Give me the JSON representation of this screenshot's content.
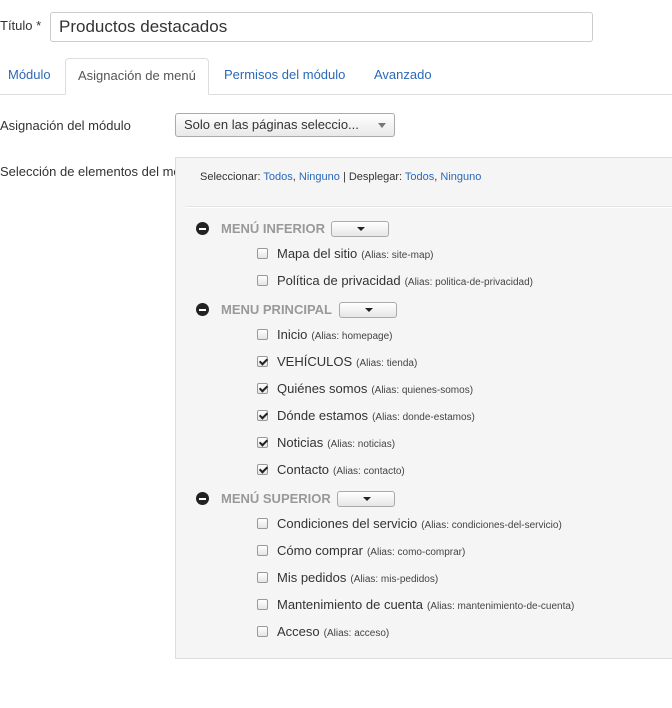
{
  "title_field": {
    "label": "Título *",
    "value": "Productos destacados"
  },
  "tabs": [
    {
      "label": "Módulo",
      "active": false
    },
    {
      "label": "Asignación de menú",
      "active": true
    },
    {
      "label": "Permisos del módulo",
      "active": false
    },
    {
      "label": "Avanzado",
      "active": false
    }
  ],
  "assignment": {
    "label": "Asignación del módulo",
    "selected": "Solo en las páginas seleccio..."
  },
  "selection": {
    "label": "Selección de elementos del menú:",
    "toolbar": {
      "select_label": "Seleccionar:",
      "all": "Todos",
      "none": "Ninguno",
      "sep": "|",
      "expand_label": "Desplegar:",
      "expand_all": "Todos",
      "expand_none": "Ninguno"
    },
    "groups": [
      {
        "title": "MENÚ INFERIOR",
        "items": [
          {
            "name": "Mapa del sitio",
            "alias": "(Alias: site-map)",
            "checked": false
          },
          {
            "name": "Política de privacidad",
            "alias": "(Alias: politica-de-privacidad)",
            "checked": false
          }
        ]
      },
      {
        "title": "MENU PRINCIPAL",
        "items": [
          {
            "name": "Inicio",
            "alias": "(Alias: homepage)",
            "checked": false
          },
          {
            "name": "VEHÍCULOS",
            "alias": "(Alias: tienda)",
            "checked": true
          },
          {
            "name": "Quiénes somos",
            "alias": "(Alias: quienes-somos)",
            "checked": true
          },
          {
            "name": "Dónde estamos",
            "alias": "(Alias: donde-estamos)",
            "checked": true
          },
          {
            "name": "Noticias",
            "alias": "(Alias: noticias)",
            "checked": true
          },
          {
            "name": "Contacto",
            "alias": "(Alias: contacto)",
            "checked": true
          }
        ]
      },
      {
        "title": "MENÚ SUPERIOR",
        "items": [
          {
            "name": "Condiciones del servicio",
            "alias": "(Alias: condiciones-del-servicio)",
            "checked": false
          },
          {
            "name": "Cómo comprar",
            "alias": "(Alias: como-comprar)",
            "checked": false
          },
          {
            "name": "Mis pedidos",
            "alias": "(Alias: mis-pedidos)",
            "checked": false
          },
          {
            "name": "Mantenimiento de cuenta",
            "alias": "(Alias: mantenimiento-de-cuenta)",
            "checked": false
          },
          {
            "name": "Acceso",
            "alias": "(Alias: acceso)",
            "checked": false
          }
        ]
      }
    ]
  }
}
